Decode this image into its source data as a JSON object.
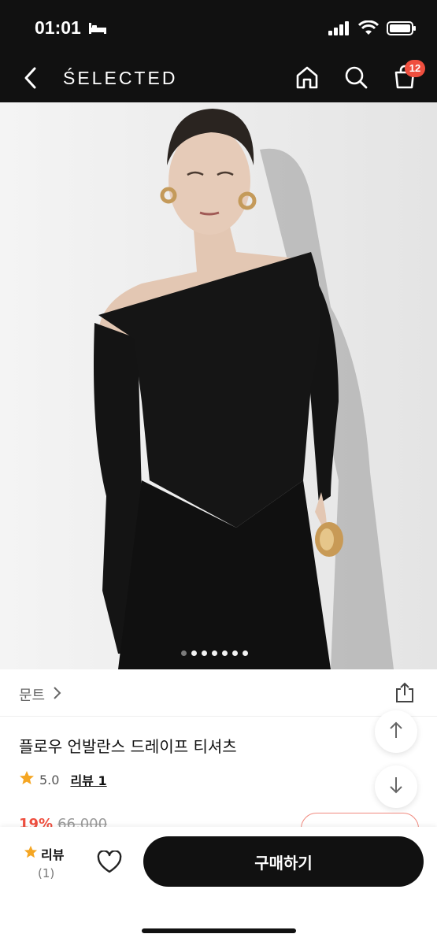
{
  "status": {
    "time": "01:01"
  },
  "nav": {
    "title": "ŚELECTED",
    "cart_count": "12"
  },
  "hero": {
    "dots_total": 7,
    "active_dot_index": 1
  },
  "product": {
    "brand": "문트",
    "name": "플로우 언발란스 드레이프 티셔츠",
    "rating": "5.0",
    "review_link": "리뷰 1",
    "discount": "19%",
    "original_price": "66,000"
  },
  "bottom": {
    "review_label": "리뷰",
    "review_count": "(1)",
    "buy_label": "구매하기"
  },
  "colors": {
    "accent": "#ef4f3f",
    "star": "#f5a623",
    "dark": "#111111"
  }
}
